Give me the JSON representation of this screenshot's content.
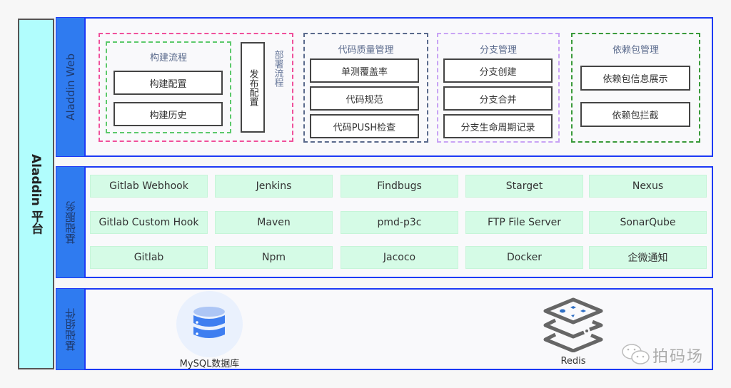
{
  "platform": {
    "label": "Aladdin 平台"
  },
  "web_layer": {
    "label": "Aladdin Web",
    "deploy_group": {
      "label": "部署流程",
      "build_group": {
        "title": "构建流程",
        "items": [
          "构建配置",
          "构建历史"
        ]
      },
      "publish_config": "发布配置"
    },
    "groups": [
      {
        "title": "代码质量管理",
        "items": [
          "单测覆盖率",
          "代码规范",
          "代码PUSH检查"
        ]
      },
      {
        "title": "分支管理",
        "items": [
          "分支创建",
          "分支合并",
          "分支生命周期记录"
        ]
      },
      {
        "title": "依赖包管理",
        "items": [
          "依赖包信息展示",
          "依赖包拦截"
        ]
      }
    ]
  },
  "service_layer": {
    "label": "基础服务",
    "rows": [
      [
        "Gitlab Webhook",
        "Jenkins",
        "Findbugs",
        "Starget",
        "Nexus"
      ],
      [
        "Gitlab Custom Hook",
        "Maven",
        "pmd-p3c",
        "FTP File Server",
        "SonarQube"
      ],
      [
        "Gitlab",
        "Npm",
        "Jacoco",
        "Docker",
        "企微通知"
      ]
    ]
  },
  "component_layer": {
    "label": "基础组件",
    "components": [
      {
        "name": "MySQL数据库",
        "icon": "database-icon"
      },
      {
        "name": "Redis",
        "icon": "layers-icon"
      }
    ]
  },
  "watermark": {
    "text": "拍码场",
    "icon": "wechat-icon"
  },
  "colors": {
    "layer_border": "#1d3af5",
    "layer_tag": "#2f7bf0",
    "platform_bg": "#b1fdfd",
    "service_bg": "#d5fbe6",
    "deploy_dash": "#f0509b",
    "build_dash": "#5cc96b",
    "quality_dash": "#5a6a8c",
    "branch_dash": "#c9a4f5",
    "dependency_dash": "#3a9a3a"
  }
}
